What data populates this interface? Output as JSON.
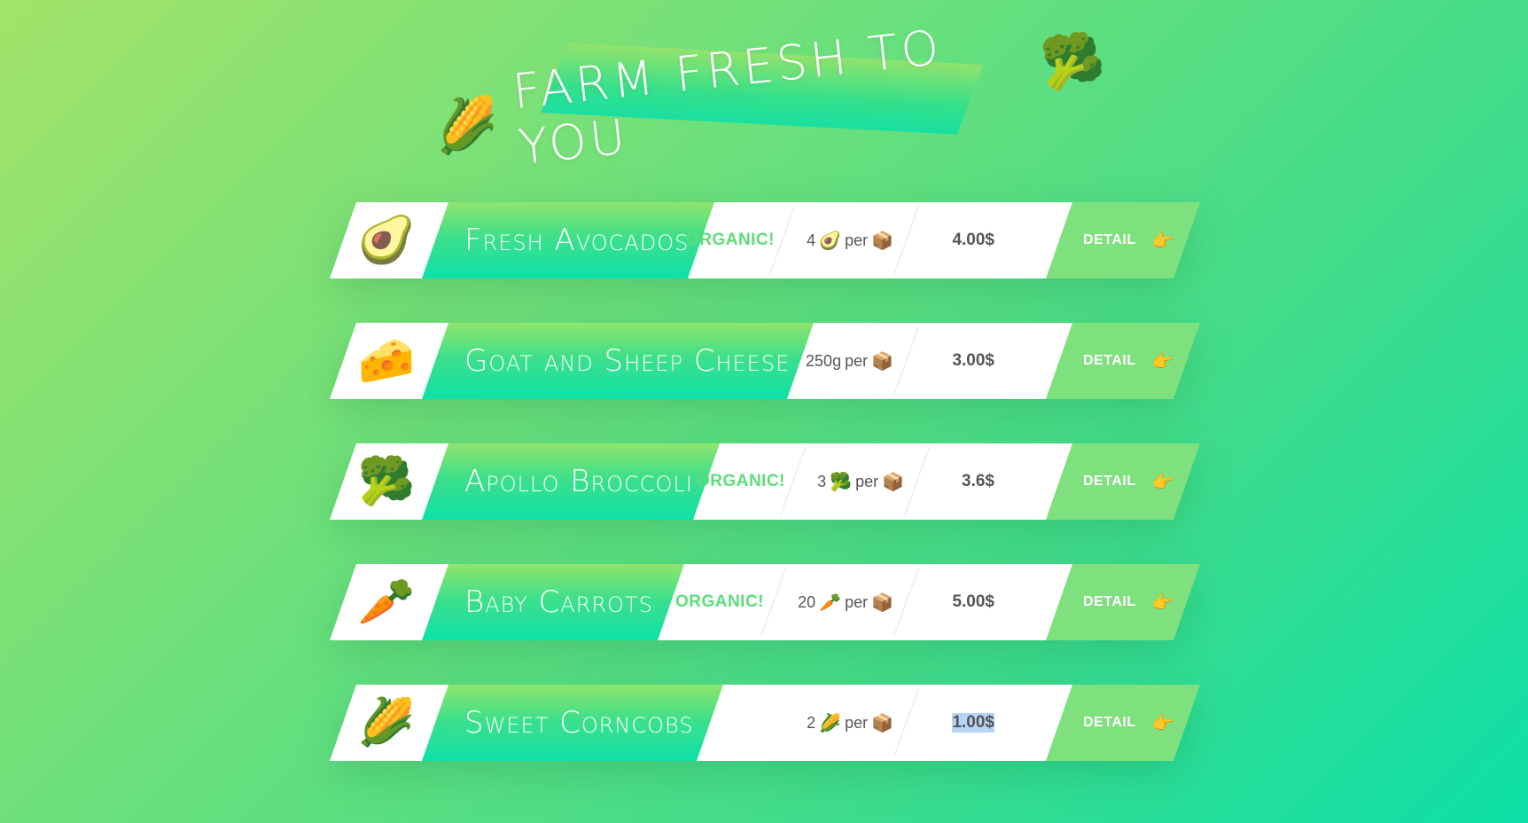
{
  "header": {
    "title": "Farm Fresh To You",
    "left_emoji": "🌽",
    "right_emoji": "🥦"
  },
  "products": [
    {
      "icon": "avocado-icon",
      "emoji": "🥑",
      "name": "Fresh Avocados",
      "organic": "ORGANIC!",
      "qty_count": "4",
      "qty_emoji": "🥑",
      "qty_per": "per",
      "box_emoji": "📦",
      "price": "4.00$",
      "detail": "DETAIL",
      "detail_emoji": "👉"
    },
    {
      "icon": "cheese-icon",
      "emoji": "🧀",
      "name": "Goat and Sheep Cheese",
      "organic": "",
      "qty_count": "250g",
      "qty_emoji": "",
      "qty_per": "per",
      "box_emoji": "📦",
      "price": "3.00$",
      "detail": "DETAIL",
      "detail_emoji": "👉"
    },
    {
      "icon": "broccoli-icon",
      "emoji": "🥦",
      "name": "Apollo Broccoli",
      "organic": "ORGANIC!",
      "qty_count": "3",
      "qty_emoji": "🥦",
      "qty_per": "per",
      "box_emoji": "📦",
      "price": "3.6$",
      "detail": "DETAIL",
      "detail_emoji": "👉"
    },
    {
      "icon": "carrot-icon",
      "emoji": "🥕",
      "name": "Baby Carrots",
      "organic": "ORGANIC!",
      "qty_count": "20",
      "qty_emoji": "🥕",
      "qty_per": "per",
      "box_emoji": "📦",
      "price": "5.00$",
      "detail": "DETAIL",
      "detail_emoji": "👉"
    },
    {
      "icon": "corn-icon",
      "emoji": "🌽",
      "name": "Sweet Corncobs",
      "organic": "",
      "qty_count": "2",
      "qty_emoji": "🌽",
      "qty_per": "per",
      "box_emoji": "📦",
      "price": "1.00$",
      "price_selected": true,
      "detail": "DETAIL",
      "detail_emoji": "👉"
    }
  ]
}
